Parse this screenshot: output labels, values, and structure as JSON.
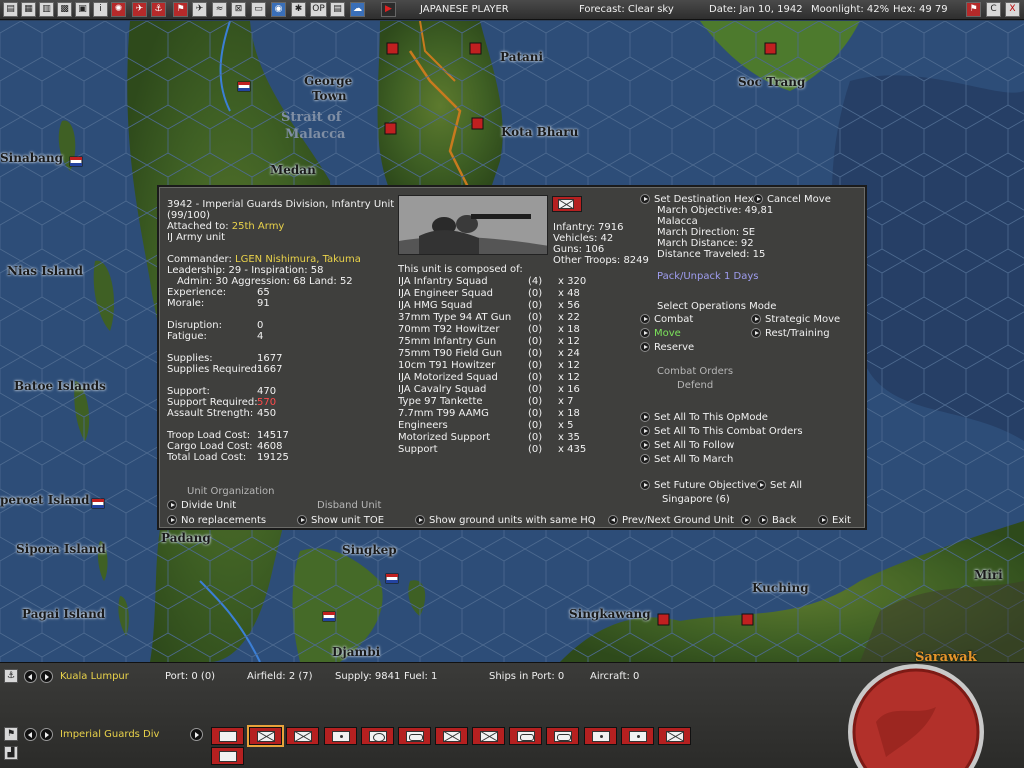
{
  "topbar": {
    "player": "JAPANESE PLAYER",
    "forecast": "Forecast: Clear sky",
    "date": "Date: Jan 10, 1942",
    "moonlight": "Moonlight: 42%",
    "hex": "Hex: 49 79",
    "btn_c": "C",
    "btn_x": "X",
    "btn_op": "OP"
  },
  "map": {
    "places": {
      "patani": "Patani",
      "george_town_1": "George",
      "george_town_2": "Town",
      "soc_trang": "Soc Trang",
      "strait_1": "Strait of",
      "strait_2": "Malacca",
      "kota_bharu": "Kota Bharu",
      "sinabang": "Sinabang",
      "medan": "Medan",
      "nias": "Nias Island",
      "batoe": "Batoe Islands",
      "benkoelen": "peroet Island",
      "sipora": "Sipora Island",
      "padang": "Padang",
      "singkep": "Singkep",
      "pagai": "Pagai Island",
      "singkawang": "Singkawang",
      "kuching": "Kuching",
      "miri": "Miri",
      "djambi": "Djambi",
      "sarawak": "Sarawak"
    }
  },
  "unit": {
    "title": "3942 - Imperial Guards Division, Infantry Unit",
    "strength": "(99/100)",
    "attached_label": "Attached to: ",
    "attached_value": "25th Army",
    "unit_type": "IJ Army unit",
    "commander_label": "Commander: ",
    "commander_value": "LGEN Nishimura, Takuma",
    "leadership": "Leadership: 29 - Inspiration: 58",
    "admin": "Admin: 30  Aggression: 68 Land: 52",
    "stats_a": [
      {
        "label": "Experience:",
        "value": "65"
      },
      {
        "label": "Morale:",
        "value": "91"
      }
    ],
    "stats_b": [
      {
        "label": "Disruption:",
        "value": "0"
      },
      {
        "label": "Fatigue:",
        "value": "4"
      }
    ],
    "stats_c": [
      {
        "label": "Supplies:",
        "value": "1677"
      },
      {
        "label": "Supplies Required:",
        "value": "1667"
      }
    ],
    "stats_d": [
      {
        "label": "Support:",
        "value": "470"
      },
      {
        "label": "Support Required:",
        "value": "570"
      },
      {
        "label": "Assault Strength:",
        "value": "450"
      }
    ],
    "stats_e": [
      {
        "label": "Troop Load Cost:",
        "value": "14517"
      },
      {
        "label": "Cargo Load Cost:",
        "value": "4608"
      },
      {
        "label": "Total Load Cost:",
        "value": "19125"
      }
    ],
    "org_title": "Unit Organization",
    "divide_unit": "Divide Unit",
    "disband_unit": "Disband Unit",
    "no_replacements": "No replacements",
    "show_toe": "Show unit TOE",
    "show_same_hq": "Show ground units with same HQ",
    "prev_next": "Prev/Next Ground Unit",
    "back": "Back",
    "exit": "Exit",
    "totals": {
      "infantry": "Infantry: 7916",
      "vehicles": "Vehicles: 42",
      "guns": "Guns: 106",
      "other": "Other Troops: 8249"
    },
    "composed_title": "This unit is composed of:",
    "composition": [
      {
        "name": "IJA Infantry Squad",
        "dmg": "(4)",
        "count": "x 320"
      },
      {
        "name": "IJA Engineer Squad",
        "dmg": "(0)",
        "count": "x 48"
      },
      {
        "name": "IJA HMG Squad",
        "dmg": "(0)",
        "count": "x 56"
      },
      {
        "name": "37mm Type 94 AT Gun",
        "dmg": "(0)",
        "count": "x 22"
      },
      {
        "name": "70mm T92 Howitzer",
        "dmg": "(0)",
        "count": "x 18"
      },
      {
        "name": "75mm Infantry Gun",
        "dmg": "(0)",
        "count": "x 12"
      },
      {
        "name": "75mm T90 Field Gun",
        "dmg": "(0)",
        "count": "x 24"
      },
      {
        "name": "10cm T91 Howitzer",
        "dmg": "(0)",
        "count": "x 12"
      },
      {
        "name": "IJA Motorized Squad",
        "dmg": "(0)",
        "count": "x 12"
      },
      {
        "name": "IJA Cavalry Squad",
        "dmg": "(0)",
        "count": "x 16"
      },
      {
        "name": "Type 97 Tankette",
        "dmg": "(0)",
        "count": "x 7"
      },
      {
        "name": "7.7mm T99 AAMG",
        "dmg": "(0)",
        "count": "x 18"
      },
      {
        "name": "Engineers",
        "dmg": "(0)",
        "count": "x 5"
      },
      {
        "name": "Motorized Support",
        "dmg": "(0)",
        "count": "x 35"
      },
      {
        "name": "Support",
        "dmg": "(0)",
        "count": "x 435"
      }
    ],
    "set_destination": "Set Destination Hex",
    "cancel_move": "Cancel Move",
    "march_objective": "March Objective: 49,81",
    "march_place": "Malacca",
    "march_direction": "March Direction: SE",
    "march_distance": "March Distance:   92",
    "distance_traveled": "Distance Traveled: 15",
    "pack_unpack": "Pack/Unpack 1 Days",
    "ops_title": "Select Operations Mode",
    "ops_combat": "Combat",
    "ops_strategic": "Strategic Move",
    "ops_move": "Move",
    "ops_rest": "Rest/Training",
    "ops_reserve": "Reserve",
    "combat_orders_title": "Combat Orders",
    "combat_orders_value": "Defend",
    "set_all_opmode": "Set All To This OpMode",
    "set_all_combat": "Set All To This Combat Orders",
    "set_all_follow": "Set All To Follow",
    "set_all_march": "Set All To March",
    "set_future": "Set Future Objective",
    "set_all": "Set All",
    "future_value": "Singapore (6)"
  },
  "bottom": {
    "base_name": "Kuala Lumpur",
    "port": "Port: 0 (0)",
    "airfield": "Airfield: 2 (7)",
    "supply": "Supply: 9841",
    "fuel": "Fuel: 1",
    "ships": "Ships in Port: 0",
    "aircraft": "Aircraft: 0",
    "unit_name": "Imperial Guards Div"
  },
  "colors": {
    "yellow_text": "#e9d24a",
    "red_text": "#ff4a4a",
    "green_text": "#7be35a",
    "japan_red": "#b52020",
    "dialog_bg": "#3f3f3d"
  }
}
